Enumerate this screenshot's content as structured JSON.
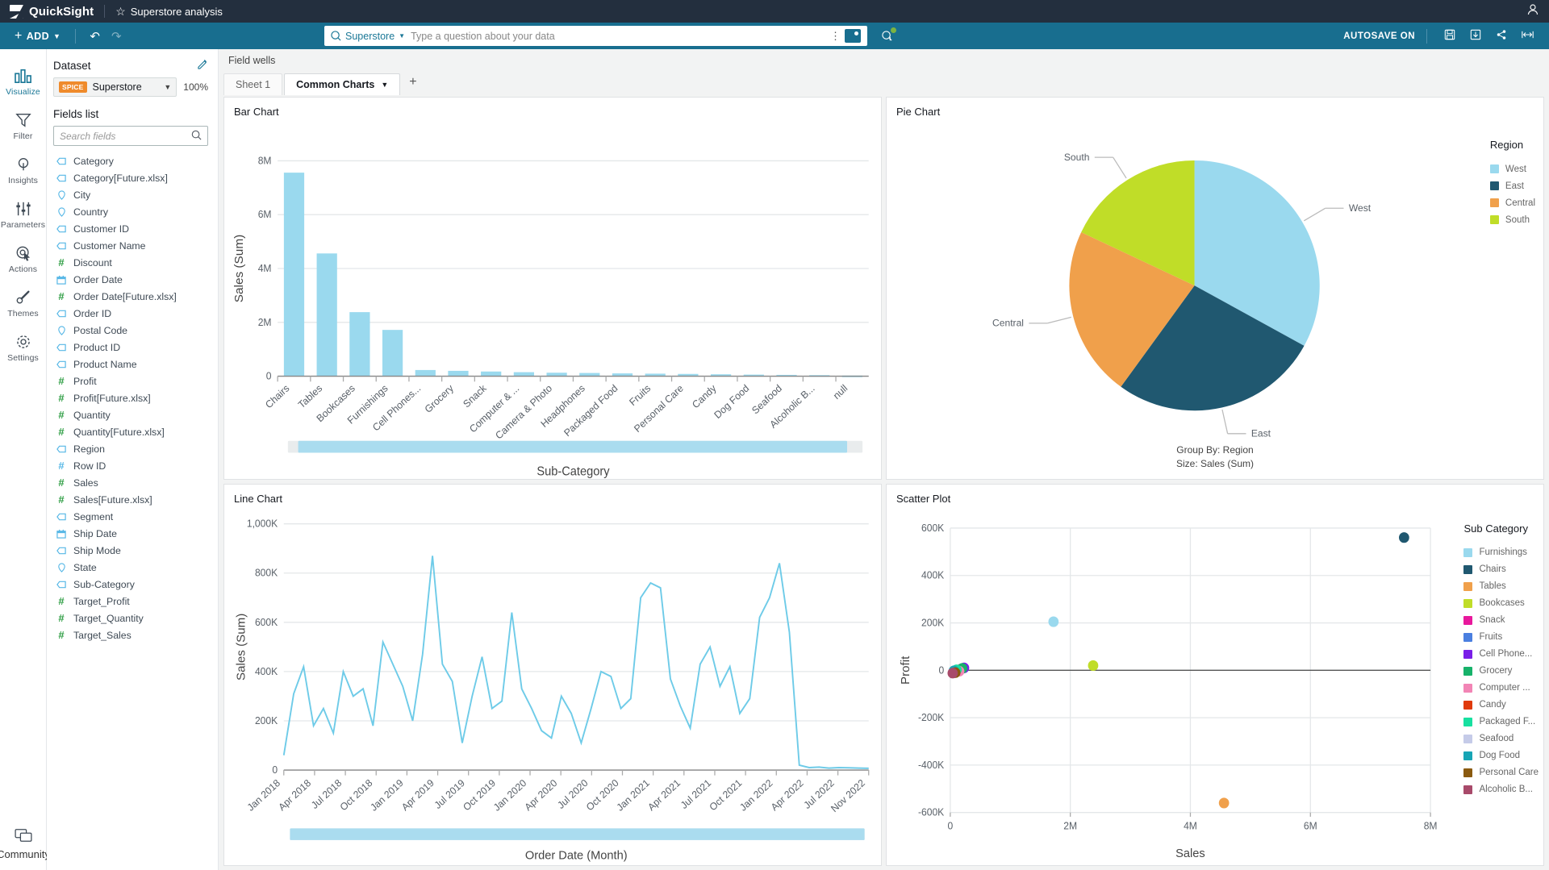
{
  "topbar": {
    "product_name": "QuickSight",
    "analysis_title": "Superstore analysis",
    "star_icon": "star-icon",
    "user_icon": "user-icon"
  },
  "toolbar": {
    "add_label": "ADD",
    "undo_icon": "undo-icon",
    "redo_icon": "redo-icon",
    "autosave_label": "AUTOSAVE ON",
    "save_icon": "save-icon",
    "export_icon": "download-icon",
    "share_icon": "share-icon",
    "fullscreen_icon": "fit-width-icon"
  },
  "qbar": {
    "dataset_label": "Superstore",
    "placeholder": "Type a question about your data",
    "q_icon": "q-search-icon",
    "kebab_icon": "kebab-menu-icon",
    "topic_icon": "topic-icon",
    "add_topic_icon": "add-topic-icon"
  },
  "rail": {
    "items": [
      {
        "label": "Visualize",
        "icon": "visualize-icon",
        "active": true
      },
      {
        "label": "Filter",
        "icon": "filter-icon",
        "active": false
      },
      {
        "label": "Insights",
        "icon": "insights-icon",
        "active": false
      },
      {
        "label": "Parameters",
        "icon": "parameters-icon",
        "active": false
      },
      {
        "label": "Actions",
        "icon": "actions-icon",
        "active": false
      },
      {
        "label": "Themes",
        "icon": "themes-icon",
        "active": false
      },
      {
        "label": "Settings",
        "icon": "settings-icon",
        "active": false
      }
    ],
    "bottom": {
      "label": "Community",
      "icon": "community-icon"
    }
  },
  "dataset_panel": {
    "heading": "Dataset",
    "edit_icon": "pencil-icon",
    "badge": "SPICE",
    "dataset_name": "Superstore",
    "zoom_level": "100%",
    "fields_heading": "Fields list",
    "search_placeholder": "Search fields",
    "search_value": "",
    "fields": [
      {
        "name": "Category",
        "type": "string"
      },
      {
        "name": "Category[Future.xlsx]",
        "type": "string"
      },
      {
        "name": "City",
        "type": "geo"
      },
      {
        "name": "Country",
        "type": "geo"
      },
      {
        "name": "Customer ID",
        "type": "string"
      },
      {
        "name": "Customer Name",
        "type": "string"
      },
      {
        "name": "Discount",
        "type": "number"
      },
      {
        "name": "Order Date",
        "type": "date"
      },
      {
        "name": "Order Date[Future.xlsx]",
        "type": "number"
      },
      {
        "name": "Order ID",
        "type": "string"
      },
      {
        "name": "Postal Code",
        "type": "geo"
      },
      {
        "name": "Product ID",
        "type": "string"
      },
      {
        "name": "Product Name",
        "type": "string"
      },
      {
        "name": "Profit",
        "type": "number"
      },
      {
        "name": "Profit[Future.xlsx]",
        "type": "number"
      },
      {
        "name": "Quantity",
        "type": "number"
      },
      {
        "name": "Quantity[Future.xlsx]",
        "type": "number"
      },
      {
        "name": "Region",
        "type": "string"
      },
      {
        "name": "Row ID",
        "type": "number-blue"
      },
      {
        "name": "Sales",
        "type": "number"
      },
      {
        "name": "Sales[Future.xlsx]",
        "type": "number"
      },
      {
        "name": "Segment",
        "type": "string"
      },
      {
        "name": "Ship Date",
        "type": "date"
      },
      {
        "name": "Ship Mode",
        "type": "string"
      },
      {
        "name": "State",
        "type": "geo"
      },
      {
        "name": "Sub-Category",
        "type": "string"
      },
      {
        "name": "Target_Profit",
        "type": "number"
      },
      {
        "name": "Target_Quantity",
        "type": "number"
      },
      {
        "name": "Target_Sales",
        "type": "number"
      }
    ]
  },
  "canvas": {
    "field_wells_label": "Field wells",
    "tabs": [
      {
        "label": "Sheet 1",
        "active": false
      },
      {
        "label": "Common Charts",
        "active": true
      }
    ],
    "add_sheet_icon": "plus-icon"
  },
  "chart_data": [
    {
      "id": "bar-chart",
      "type": "bar",
      "title": "Bar Chart",
      "xlabel": "Sub-Category",
      "ylabel": "Sales (Sum)",
      "ylim": [
        0,
        8000000
      ],
      "yticks": [
        "0",
        "2M",
        "4M",
        "6M",
        "8M"
      ],
      "categories": [
        "Chairs",
        "Tables",
        "Bookcases",
        "Furnishings",
        "Cell Phones...",
        "Grocery",
        "Snack",
        "Computer & ...",
        "Camera & Photo",
        "Headphones",
        "Packaged Food",
        "Fruits",
        "Personal Care",
        "Candy",
        "Dog Food",
        "Seafood",
        "Alcoholic B...",
        "null"
      ],
      "values": [
        7560000,
        4560000,
        2380000,
        1720000,
        230000,
        200000,
        175000,
        150000,
        130000,
        120000,
        105000,
        95000,
        85000,
        72000,
        60000,
        50000,
        40000,
        25000
      ],
      "bar_color": "#9ad9ee",
      "grid": true
    },
    {
      "id": "pie-chart",
      "type": "pie",
      "title": "Pie Chart",
      "legend_title": "Region",
      "footer_lines": [
        "Group By: Region",
        "Size: Sales (Sum)"
      ],
      "labels": [
        "West",
        "East",
        "Central",
        "South"
      ],
      "values": [
        33,
        27,
        22,
        18
      ],
      "colors": [
        "#9ad9ee",
        "#205870",
        "#f3a košt",
        "#c0dd28"
      ],
      "slice_colors": [
        "#9ad9ee",
        "#205870",
        "#f0a04b",
        "#c0dd28"
      ],
      "callouts": [
        "South",
        "West",
        "Central",
        "East"
      ]
    },
    {
      "id": "line-chart",
      "type": "line",
      "title": "Line Chart",
      "xlabel": "Order Date (Month)",
      "ylabel": "Sales (Sum)",
      "ylim": [
        0,
        1000000
      ],
      "yticks": [
        "0",
        "200K",
        "400K",
        "600K",
        "800K",
        "1,000K"
      ],
      "xticks": [
        "Jan 2018",
        "Apr 2018",
        "Jul 2018",
        "Oct 2018",
        "Jan 2019",
        "Apr 2019",
        "Jul 2019",
        "Oct 2019",
        "Jan 2020",
        "Apr 2020",
        "Jul 2020",
        "Oct 2020",
        "Jan 2021",
        "Apr 2021",
        "Jul 2021",
        "Oct 2021",
        "Jan 2022",
        "Apr 2022",
        "Jul 2022",
        "Nov 2022"
      ],
      "line_color": "#6ecbe8",
      "values": [
        60000,
        310000,
        420000,
        180000,
        250000,
        150000,
        400000,
        300000,
        330000,
        180000,
        520000,
        430000,
        340000,
        200000,
        470000,
        870000,
        430000,
        360000,
        110000,
        300000,
        460000,
        250000,
        280000,
        640000,
        330000,
        250000,
        160000,
        130000,
        300000,
        230000,
        110000,
        250000,
        400000,
        380000,
        250000,
        290000,
        700000,
        760000,
        740000,
        370000,
        260000,
        170000,
        430000,
        500000,
        340000,
        420000,
        230000,
        290000,
        620000,
        700000,
        840000,
        560000,
        20000,
        10000,
        12000,
        8000,
        10000,
        9000,
        8000,
        7000
      ]
    },
    {
      "id": "scatter-plot",
      "type": "scatter",
      "title": "Scatter Plot",
      "xlabel": "Sales",
      "ylabel": "Profit",
      "legend_title": "Sub Category",
      "xticks": [
        "0",
        "2M",
        "4M",
        "6M",
        "8M"
      ],
      "yticks": [
        "-600K",
        "-400K",
        "-200K",
        "0",
        "200K",
        "400K",
        "600K"
      ],
      "xlim": [
        0,
        8000000
      ],
      "ylim": [
        -600000,
        600000
      ],
      "points": [
        {
          "label": "Chairs",
          "x": 7560000,
          "y": 560000,
          "color": "#205870"
        },
        {
          "label": "Tables",
          "x": 4560000,
          "y": -560000,
          "color": "#f0a04b"
        },
        {
          "label": "Bookcases",
          "x": 2380000,
          "y": 20000,
          "color": "#c0dd28"
        },
        {
          "label": "Furnishings",
          "x": 1720000,
          "y": 205000,
          "color": "#9ad9ee"
        },
        {
          "label": "Snack",
          "x": 175000,
          "y": 5000,
          "color": "#e8189c"
        },
        {
          "label": "Fruits",
          "x": 95000,
          "y": 0,
          "color": "#4a7fe0"
        },
        {
          "label": "Cell Phone...",
          "x": 230000,
          "y": 10000,
          "color": "#7a1fe8"
        },
        {
          "label": "Grocery",
          "x": 200000,
          "y": 8000,
          "color": "#17b26a"
        },
        {
          "label": "Computer ...",
          "x": 150000,
          "y": -4000,
          "color": "#f285b5"
        },
        {
          "label": "Candy",
          "x": 72000,
          "y": -8000,
          "color": "#e03a0c"
        },
        {
          "label": "Packaged F...",
          "x": 105000,
          "y": 2000,
          "color": "#17e0a0"
        },
        {
          "label": "Seafood",
          "x": 50000,
          "y": -6000,
          "color": "#c5cbe8"
        },
        {
          "label": "Dog Food",
          "x": 60000,
          "y": -2000,
          "color": "#17a5b5"
        },
        {
          "label": "Personal Care",
          "x": 85000,
          "y": -10000,
          "color": "#8a5a10"
        },
        {
          "label": "Alcoholic B...",
          "x": 40000,
          "y": -12000,
          "color": "#a84a6a"
        }
      ],
      "legend_items": [
        {
          "label": "Furnishings",
          "color": "#9ad9ee"
        },
        {
          "label": "Chairs",
          "color": "#205870"
        },
        {
          "label": "Tables",
          "color": "#f0a04b"
        },
        {
          "label": "Bookcases",
          "color": "#c0dd28"
        },
        {
          "label": "Snack",
          "color": "#e8189c"
        },
        {
          "label": "Fruits",
          "color": "#4a7fe0"
        },
        {
          "label": "Cell Phone...",
          "color": "#7a1fe8"
        },
        {
          "label": "Grocery",
          "color": "#17b26a"
        },
        {
          "label": "Computer ...",
          "color": "#f285b5"
        },
        {
          "label": "Candy",
          "color": "#e03a0c"
        },
        {
          "label": "Packaged F...",
          "color": "#17e0a0"
        },
        {
          "label": "Seafood",
          "color": "#c5cbe8"
        },
        {
          "label": "Dog Food",
          "color": "#17a5b5"
        },
        {
          "label": "Personal Care",
          "color": "#8a5a10"
        },
        {
          "label": "Alcoholic B...",
          "color": "#a84a6a"
        }
      ]
    }
  ],
  "pie_legend": [
    {
      "label": "West",
      "color": "#9ad9ee"
    },
    {
      "label": "East",
      "color": "#205870"
    },
    {
      "label": "Central",
      "color": "#f0a04b"
    },
    {
      "label": "South",
      "color": "#c0dd28"
    }
  ]
}
